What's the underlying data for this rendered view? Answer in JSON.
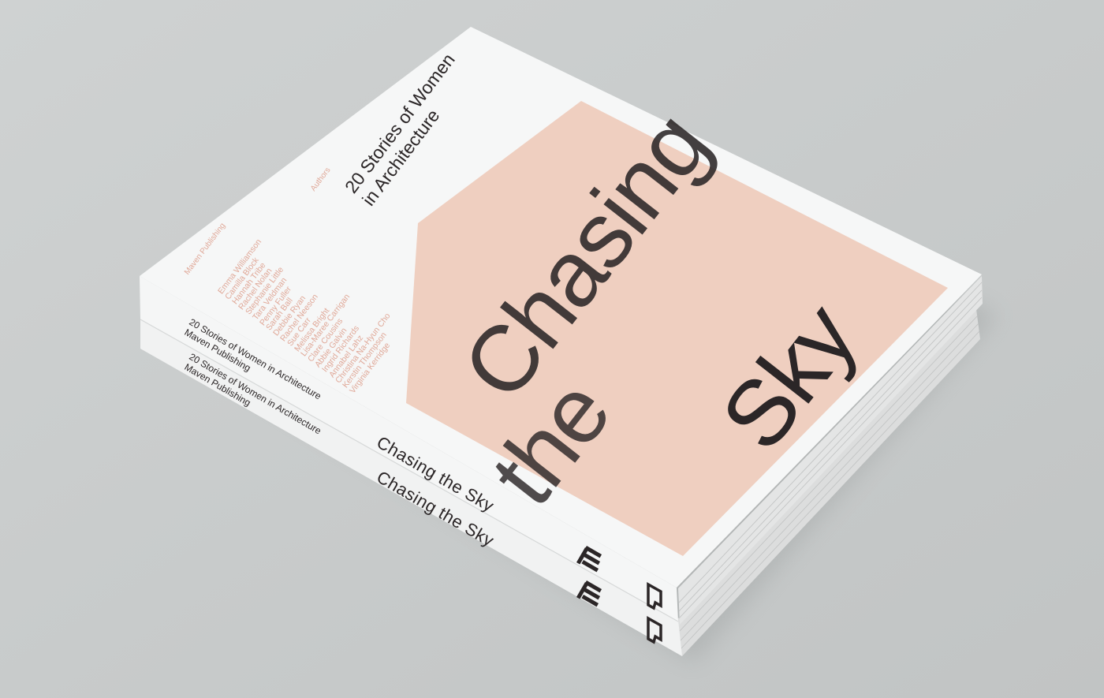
{
  "book": {
    "title_chasing": "Chasing",
    "title_the": "the",
    "title_sky": "Sky",
    "subtitle_line1": "20 Stories of Women",
    "subtitle_line2": "in Architecture",
    "authors_label": "Authors",
    "publisher_label": "Maven Publishing",
    "authors": [
      "Emma Williamson",
      "Camilla Block",
      "Hannah Tribe",
      "Rachel Nolan",
      "Stephanie Little",
      "Tara Veldman",
      "Penny Fuller",
      "Sarah Ball",
      "Debbie Ryan",
      "Rachel Neeson",
      "Sue Carr",
      "Melissa Bright",
      "Lisa-Maree Carrigan",
      "Clare Cousins",
      "Abbie Galvin",
      "Ingrid Richards",
      "Annabel Lahz",
      "Christina Na-Hyun Cho",
      "Kerstin Thompson",
      "Virginia Kerridge"
    ],
    "spines": [
      {
        "subtitle": "20 Stories of Women in Architecture",
        "publisher": "Maven Publishing",
        "title": "Chasing the Sky"
      },
      {
        "subtitle": "20 Stories of Women in Architecture",
        "publisher": "Maven Publishing",
        "title": "Chasing the Sky"
      }
    ]
  },
  "colors": {
    "background": "#c9cccc",
    "cover": "#f6f7f7",
    "pink_block": "#efcfc0",
    "type_dark": "#2b2627",
    "author_pink": "#e0a999"
  }
}
